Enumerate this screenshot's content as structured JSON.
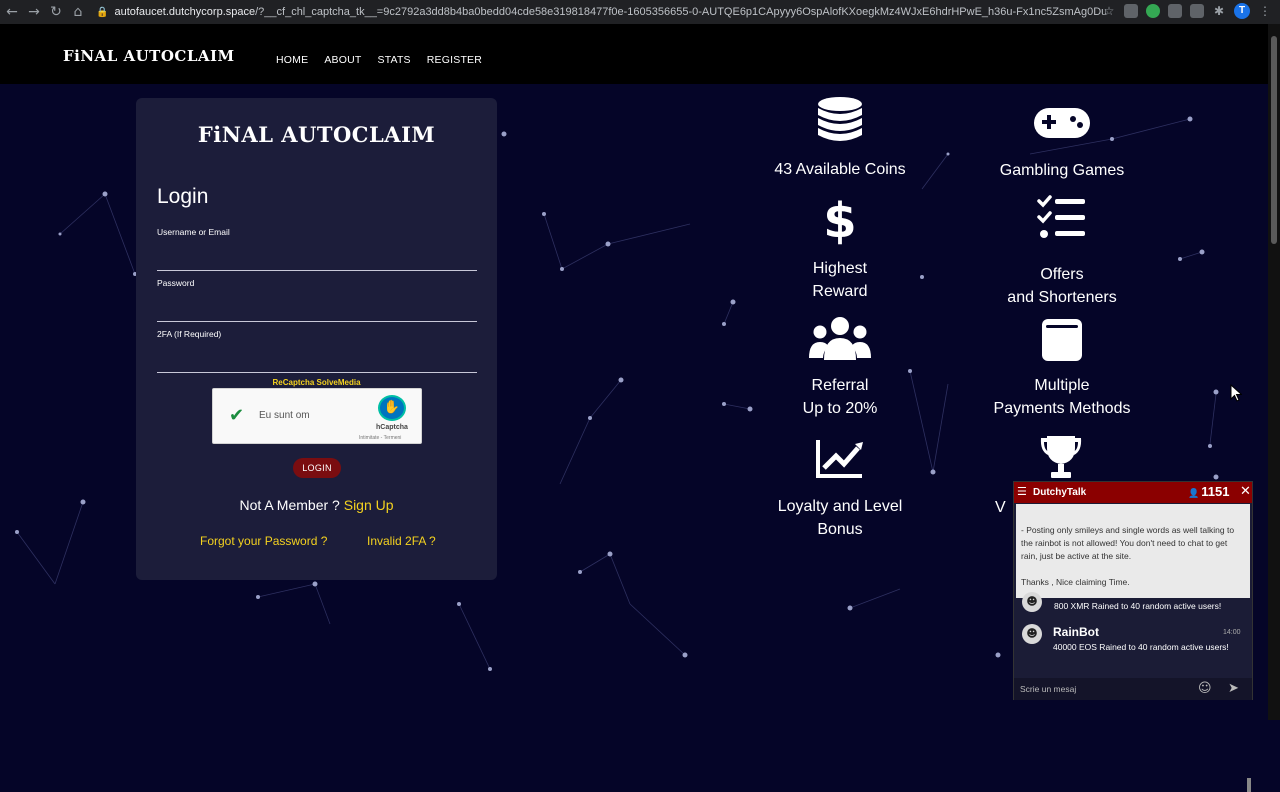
{
  "browser": {
    "url_host": "autofaucet.dutchycorp.space",
    "url_rest": "/?__cf_chl_captcha_tk__=9c2792a3dd8b4ba0bedd04cde58e319818477f0e-1605356655-0-AUTQE6p1CApyyy6OspAlofKXoegkMz4WJxE6hdrHPwE_h36u-Fx1nc5ZsmAg0DutQuvNRqchQNDC0pQEzF...",
    "profile_initial": "T"
  },
  "header": {
    "brand": "FiNAL AUTOCLAIM",
    "nav": [
      "HOME",
      "ABOUT",
      "STATS",
      "REGISTER"
    ]
  },
  "login": {
    "logo": "FiNAL AUTOCLAIM",
    "title": "Login",
    "username_label": "Username or Email",
    "password_label": "Password",
    "twofa_label": "2FA (If Required)",
    "captcha_selector": "ReCaptcha SolveMedia",
    "captcha_status": "Eu sunt om",
    "captcha_brand": "hCaptcha",
    "captcha_footer": "Intimitate - Termeni",
    "login_button": "LOGIN",
    "not_member": "Not A Member ?",
    "sign_up": "Sign Up",
    "forgot": "Forgot your Password ?",
    "invalid_2fa": "Invalid 2FA ?"
  },
  "features": [
    {
      "line1": "43 Available Coins",
      "line2": "",
      "icon": "coins-icon"
    },
    {
      "line1": "Gambling Games",
      "line2": "",
      "icon": "gamepad-icon"
    },
    {
      "line1": "Highest",
      "line2": "Reward",
      "icon": "dollar-icon"
    },
    {
      "line1": "Offers",
      "line2": "and Shorteners",
      "icon": "checklist-icon"
    },
    {
      "line1": "Referral",
      "line2": "Up to 20%",
      "icon": "users-icon"
    },
    {
      "line1": "Multiple",
      "line2": "Payments Methods",
      "icon": "wallet-icon"
    },
    {
      "line1": "Loyalty and Level",
      "line2": "Bonus",
      "icon": "chart-icon"
    },
    {
      "line1": "V",
      "line2": "",
      "icon": "trophy-icon"
    }
  ],
  "chat": {
    "title": "DutchyTalk",
    "user_count": "1151",
    "notice_line1": "- Posting only smileys and single words as well talking to the rainbot is not allowed! You don't need to chat to get rain, just be active at the site.",
    "notice_line2": "Thanks , Nice claiming Time.",
    "msg1_text": "800 XMR Rained to 40 random active users!",
    "msg2_name": "RainBot",
    "msg2_time": "14:00",
    "msg2_text": "40000 EOS Rained to 40 random active users!",
    "input_placeholder": "Scrie un mesaj"
  },
  "colors": {
    "background": "#050528",
    "panel": "#1c1d3a",
    "accent_yellow": "#f4d21f",
    "login_button": "#7a0d10",
    "chat_header": "#8b0000"
  }
}
